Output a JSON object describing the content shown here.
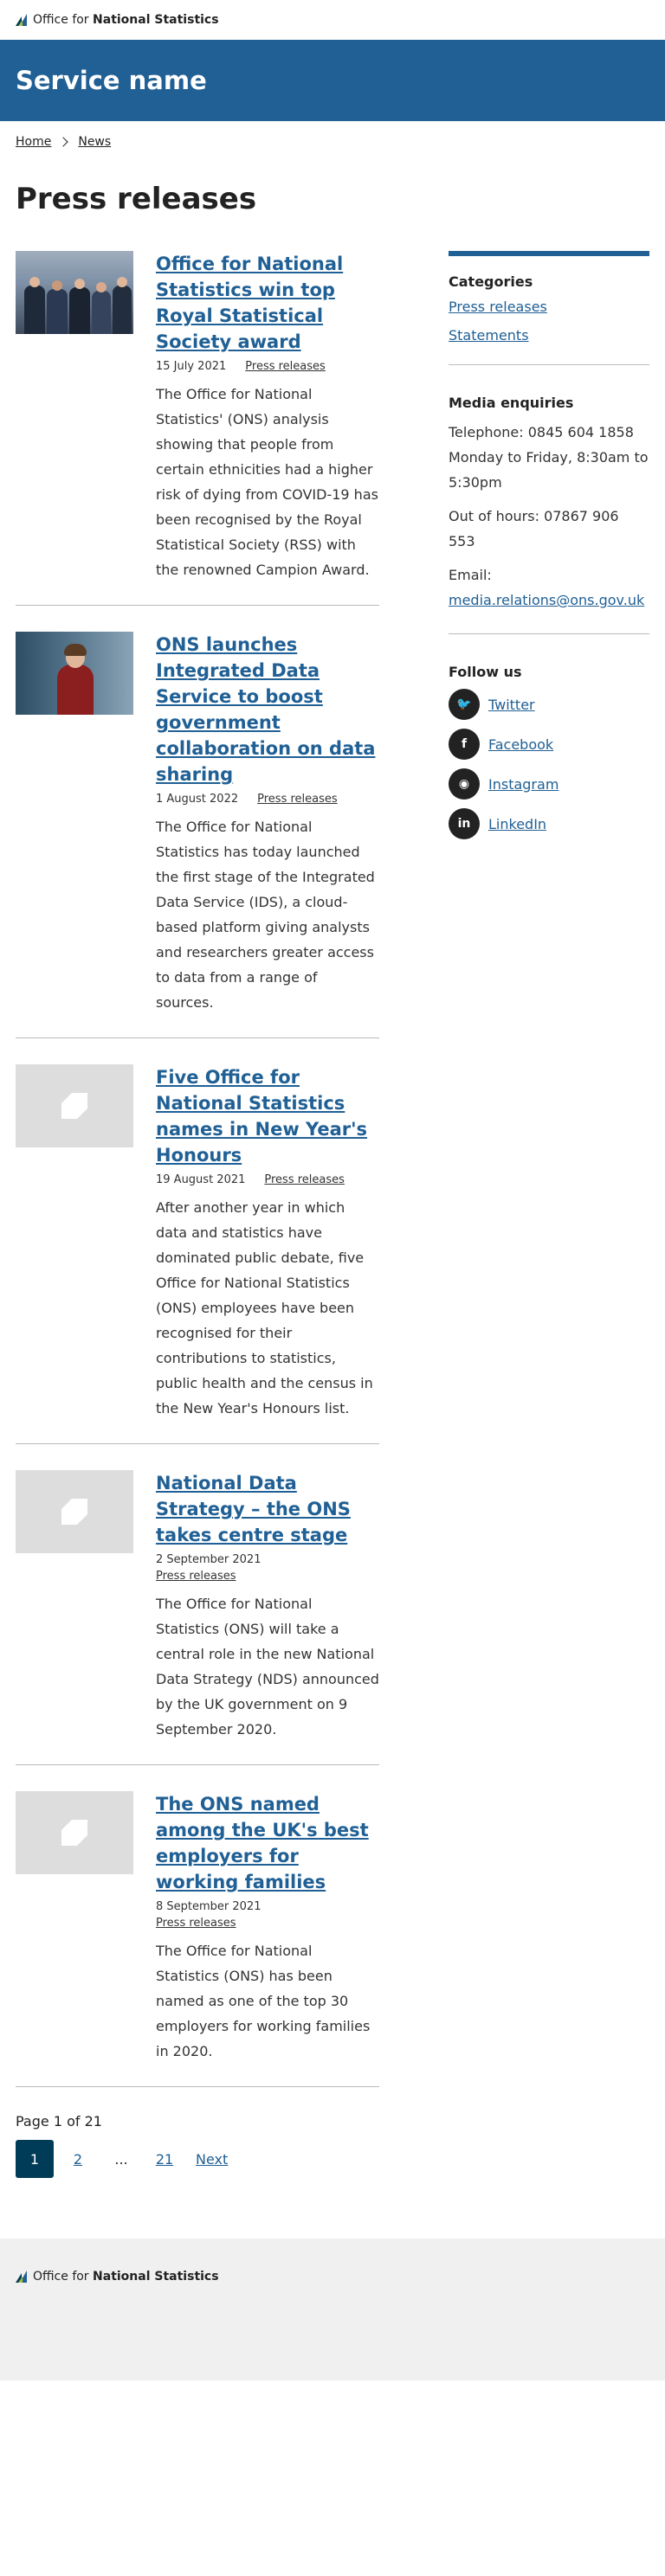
{
  "brand": {
    "office_for": "Office for",
    "national_statistics": "National Statistics"
  },
  "header": {
    "service_name": "Service name"
  },
  "breadcrumb": {
    "home": "Home",
    "news": "News"
  },
  "page": {
    "title": "Press releases"
  },
  "articles": [
    {
      "title": "Office for National Statistics win top Royal Statistical Society award",
      "date": "15 July 2021",
      "category": "Press releases",
      "description": "The Office for National Statistics' (ONS) analysis showing that people from certain ethnicities had a higher risk of dying from COVID-19 has been recognised by the Royal Statistical Society (RSS) with the renowned Campion Award."
    },
    {
      "title": "ONS launches Integrated Data Service to boost government collaboration on data sharing",
      "date": "1 August 2022",
      "category": "Press releases",
      "description": "The Office for National Statistics has today launched the first stage of the Integrated Data Service (IDS), a cloud-based platform giving analysts and researchers greater access to data from a range of sources."
    },
    {
      "title": "Five Office for National Statistics names in New Year's Honours",
      "date": "19 August 2021",
      "category": "Press releases",
      "description": "After another year in which data and statistics have dominated public debate, five Office for National Statistics (ONS) employees have been recognised for their contributions to statistics, public health and the census in the New Year's Honours list."
    },
    {
      "title": "National Data Strategy – the ONS takes centre stage",
      "date": "2 September 2021",
      "category": "Press releases",
      "description": "The Office for National Statistics (ONS) will take a central role in the new National Data Strategy (NDS) announced by the UK government on 9 September 2020."
    },
    {
      "title": "The ONS named among the UK's best employers for working families",
      "date": "8 September 2021",
      "category": "Press releases",
      "description": "The Office for National Statistics (ONS) has been named as one of the top 30 employers for working families in 2020."
    }
  ],
  "pagination": {
    "label": "Page 1 of 21",
    "current": "1",
    "page2": "2",
    "ellipsis": "...",
    "last": "21",
    "next": "Next"
  },
  "sidebar": {
    "categories_heading": "Categories",
    "categories": [
      "Press releases",
      "Statements"
    ],
    "media_heading": "Media enquiries",
    "telephone": "Telephone: 0845 604 1858",
    "hours": "Monday to Friday, 8:30am to 5:30pm",
    "out_of_hours": "Out of hours: 07867 906 553",
    "email_label": "Email:",
    "email": "media.relations@ons.gov.uk",
    "follow_heading": "Follow us",
    "social": [
      {
        "label": "Twitter",
        "icon": "twitter-icon"
      },
      {
        "label": "Facebook",
        "icon": "facebook-icon"
      },
      {
        "label": "Instagram",
        "icon": "instagram-icon"
      },
      {
        "label": "LinkedIn",
        "icon": "linkedin-icon"
      }
    ]
  },
  "colors": {
    "primary": "#206095",
    "dark": "#003c57",
    "accent": "#a8bd3a"
  }
}
